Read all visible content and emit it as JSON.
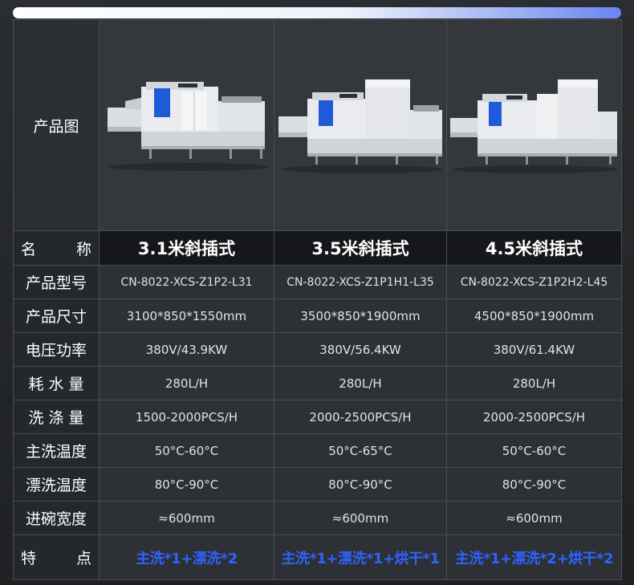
{
  "header_labels": {
    "image": "产品图",
    "name_left": "名",
    "name_right": "称",
    "feature_left": "特",
    "feature_right": "点"
  },
  "rows": [
    {
      "label": "产品型号",
      "values": [
        "CN-8022-XCS-Z1P2-L31",
        "CN-8022-XCS-Z1P1H1-L35",
        "CN-8022-XCS-Z1P2H2-L45"
      ]
    },
    {
      "label": "产品尺寸",
      "values": [
        "3100*850*1550mm",
        "3500*850*1900mm",
        "4500*850*1900mm"
      ]
    },
    {
      "label": "电压功率",
      "values": [
        "380V/43.9KW",
        "380V/56.4KW",
        "380V/61.4KW"
      ]
    },
    {
      "label": "耗 水 量",
      "values": [
        "280L/H",
        "280L/H",
        "280L/H"
      ]
    },
    {
      "label": "洗 涤 量",
      "values": [
        "1500-2000PCS/H",
        "2000-2500PCS/H",
        "2000-2500PCS/H"
      ]
    },
    {
      "label": "主洗温度",
      "values": [
        "50°C-60°C",
        "50°C-65°C",
        "50°C-60°C"
      ]
    },
    {
      "label": "漂洗温度",
      "values": [
        "80°C-90°C",
        "80°C-90°C",
        "80°C-90°C"
      ]
    },
    {
      "label": "进碗宽度",
      "values": [
        "≈600mm",
        "≈600mm",
        "≈600mm"
      ]
    }
  ],
  "products": [
    {
      "name": "3.1米斜插式",
      "feature": "主洗*1+漂洗*2"
    },
    {
      "name": "3.5米斜插式",
      "feature": "主洗*1+漂洗*1+烘干*1"
    },
    {
      "name": "4.5米斜插式",
      "feature": "主洗*1+漂洗*2+烘干*2"
    }
  ],
  "colors": {
    "feature_text": "#2f62ff",
    "background": "#25282c",
    "border": "#4a4d52"
  }
}
